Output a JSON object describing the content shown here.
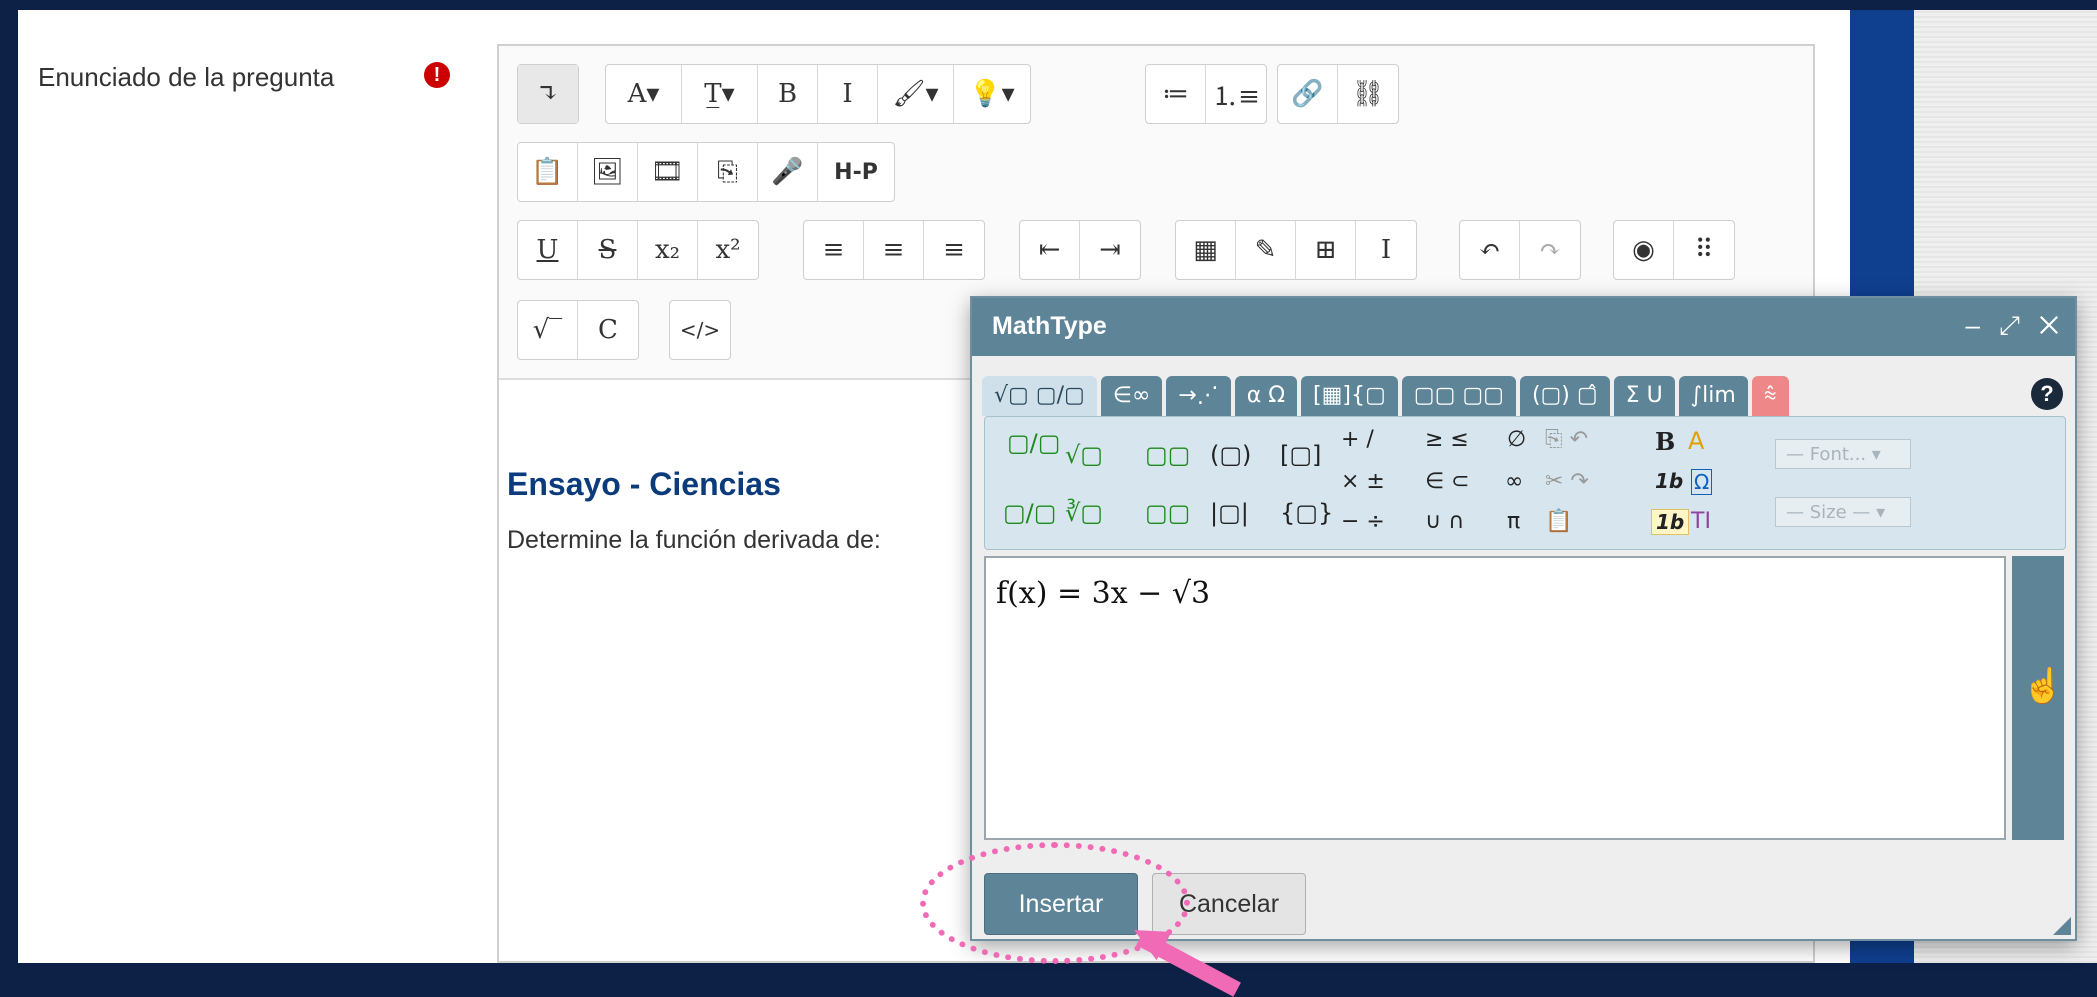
{
  "form": {
    "question_label": "Enunciado de la pregunta",
    "required_icon": "exclamation-icon"
  },
  "toolbar": {
    "row1": [
      "↴",
      "A▾",
      "T̲▾",
      "B",
      "I",
      "🖌▾",
      "💡▾",
      "≔",
      "⒈≡",
      "🔗",
      "⛓"
    ],
    "row2": [
      "📋",
      "🖼",
      "🎞",
      "⎘",
      "🎤",
      "H-P"
    ],
    "row3": [
      "U",
      "S",
      "x₂",
      "x²",
      "≡",
      "≡",
      "≡",
      "⇤",
      "⇥",
      "▦",
      "✎",
      "⊞",
      "I",
      "↶",
      "↷",
      "◉",
      "⠿"
    ],
    "row4": [
      "√‾",
      "C",
      "</>"
    ]
  },
  "content": {
    "title": "Ensayo - Ciencias",
    "text": "Determine la función derivada de:"
  },
  "mathtype": {
    "title": "MathType",
    "window_controls": "– ⤢ ✕",
    "tabs": [
      "√▢ ▢/▢",
      "∈∞",
      "→⋰",
      "α Ω",
      "[▦]{▢",
      "▢▢ ▢▢",
      "(▢) ▢̂",
      "Σ U",
      "∫lim",
      "⩯"
    ],
    "help": "?",
    "font_placeholder": "— Font... ▾",
    "size_placeholder": "— Size — ▾",
    "formula": "f(x) = 3x − √3",
    "insert_label": "Insertar",
    "cancel_label": "Cancelar"
  },
  "palette_icons": {
    "frac": "▢/▢",
    "sqrt": "√▢",
    "sup": "▢▢",
    "paren": "(▢)",
    "bracket": "[▢]",
    "ops1": "+   /",
    "ops2": "×   ±",
    "ops3": "−   ÷",
    "rel1": "≥   ≤",
    "rel2": "∈   ⊂",
    "rel3": "∪   ∩",
    "misc1": "∅",
    "misc2": "∞",
    "misc3": "π",
    "slashfrac": "▢/▢",
    "nroot": "∛▢",
    "sub": "▢▢",
    "abs": "|▢|",
    "brace": "{▢}",
    "bold": "B",
    "italic": "1b",
    "italic2": "1b",
    "omega": "Ω",
    "ti": "TI"
  }
}
